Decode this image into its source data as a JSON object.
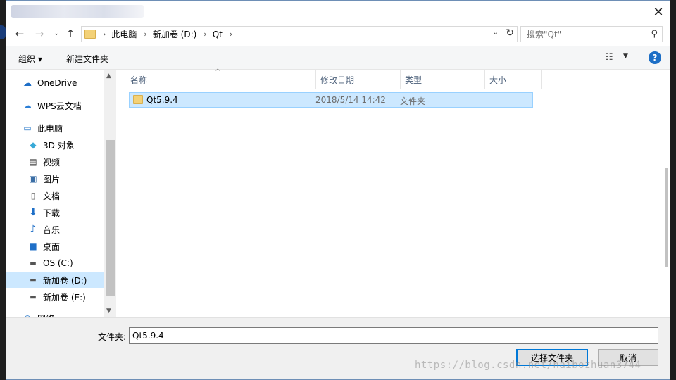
{
  "window": {
    "close_symbol": "✕"
  },
  "nav": {
    "back_icon": "back-arrow-icon",
    "forward_icon": "forward-arrow-icon",
    "recent_icon": "chevron-down-icon",
    "up_icon": "up-arrow-icon"
  },
  "address": {
    "crumbs": [
      "此电脑",
      "新加卷 (D:)",
      "Qt"
    ]
  },
  "search": {
    "placeholder": "搜索\"Qt\""
  },
  "toolbar": {
    "organize": "组织 ▾",
    "new_folder": "新建文件夹",
    "help": "?"
  },
  "sidebar": {
    "items": [
      {
        "label": "OneDrive",
        "icon": "cloud-icon"
      },
      {
        "label": "WPS云文档",
        "icon": "cloud-outline-icon"
      },
      {
        "label": "此电脑",
        "icon": "computer-icon"
      },
      {
        "label": "3D 对象",
        "icon": "cube-icon"
      },
      {
        "label": "视频",
        "icon": "film-icon"
      },
      {
        "label": "图片",
        "icon": "picture-icon"
      },
      {
        "label": "文档",
        "icon": "document-icon"
      },
      {
        "label": "下载",
        "icon": "download-icon"
      },
      {
        "label": "音乐",
        "icon": "music-icon"
      },
      {
        "label": "桌面",
        "icon": "desktop-icon"
      },
      {
        "label": "OS (C:)",
        "icon": "drive-icon"
      },
      {
        "label": "新加卷 (D:)",
        "icon": "drive-icon",
        "selected": true
      },
      {
        "label": "新加卷 (E:)",
        "icon": "drive-icon"
      },
      {
        "label": "网络",
        "icon": "network-icon"
      }
    ]
  },
  "columns": {
    "name": "名称",
    "modified": "修改日期",
    "type": "类型",
    "size": "大小"
  },
  "files": [
    {
      "name": "Qt5.9.4",
      "modified": "2018/5/14 14:42",
      "type": "文件夹",
      "size": ""
    }
  ],
  "footer": {
    "folder_label": "文件夹:",
    "folder_value": "Qt5.9.4",
    "select_button": "选择文件夹",
    "cancel_button": "取消",
    "watermark": "https://blog.csdn.net/naibozhuan3744"
  }
}
